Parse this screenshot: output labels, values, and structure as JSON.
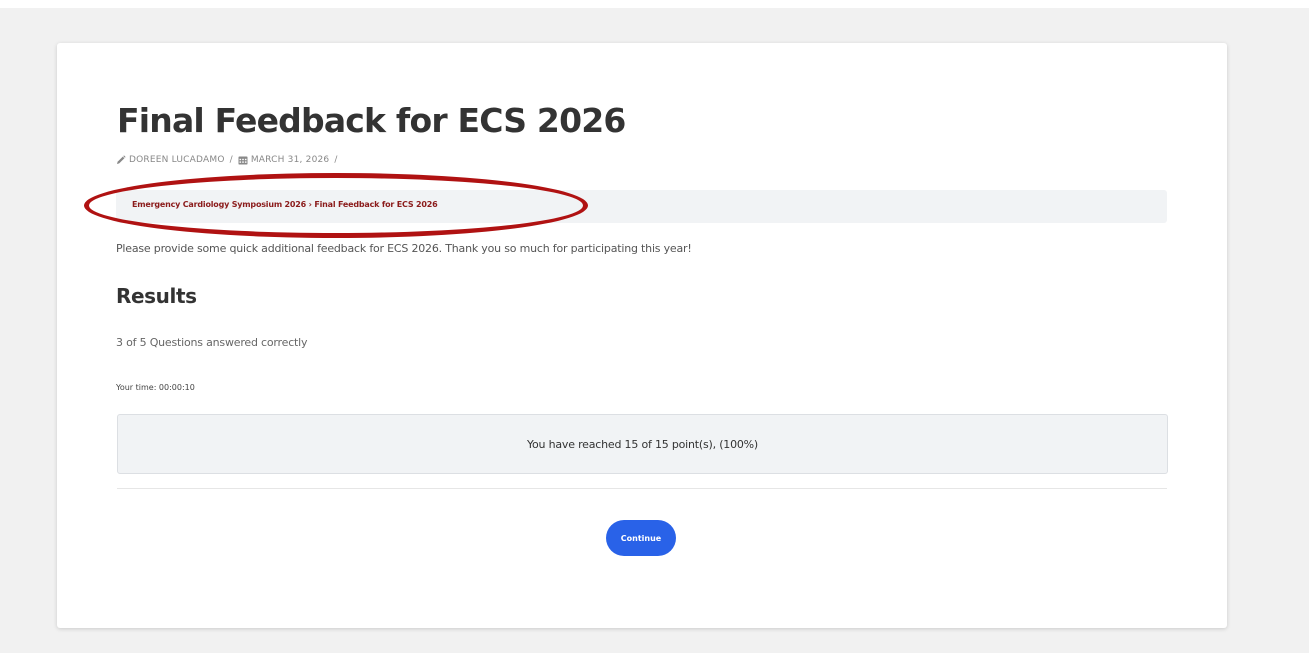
{
  "page": {
    "title": "Final Feedback for ECS 2026",
    "meta": {
      "author": "DOREEN LUCADAMO",
      "date": "MARCH 31, 2026",
      "separator": "/",
      "author_icon": "pencil-icon",
      "date_icon": "calendar-icon"
    },
    "breadcrumb": {
      "parent": "Emergency Cardiology Symposium 2026",
      "separator": "›",
      "current": "Final Feedback for ECS 2026"
    },
    "description": "Please provide some quick additional feedback for ECS 2026. Thank you so much for participating this year!"
  },
  "results": {
    "heading": "Results",
    "answered": "3 of 5 Questions answered correctly",
    "time": "Your time: 00:00:10",
    "score": "You have reached 15 of 15 point(s), (100%)"
  },
  "actions": {
    "continue_label": "Continue"
  },
  "annotation": {
    "type": "red-ellipse-highlight",
    "color": "#b01212"
  },
  "colors": {
    "accent": "#2962e8",
    "breadcrumb": "#8b1b1b",
    "background": "#f1f1f1",
    "card": "#ffffff"
  }
}
